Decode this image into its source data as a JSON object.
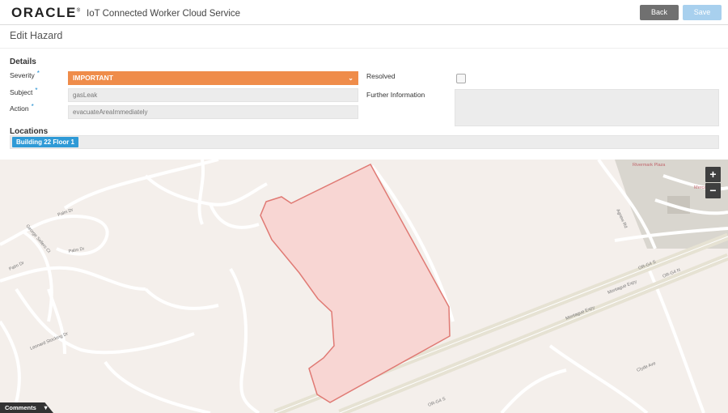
{
  "header": {
    "logo": "ORACLE",
    "logo_registered": "®",
    "app_title": "IoT Connected Worker Cloud Service",
    "back_label": "Back",
    "save_label": "Save"
  },
  "page": {
    "title": "Edit Hazard"
  },
  "details": {
    "section_title": "Details",
    "severity_label": "Severity",
    "severity_value": "IMPORTANT",
    "subject_label": "Subject",
    "subject_value": "gasLeak",
    "action_label": "Action",
    "action_value": "evacuateAreaImmediately",
    "resolved_label": "Resolved",
    "further_info_label": "Further Information",
    "further_info_value": "",
    "required_marker": "*"
  },
  "locations": {
    "section_title": "Locations",
    "chips": [
      "Building 22 Floor 1"
    ]
  },
  "map": {
    "zoom_in": "+",
    "zoom_out": "−",
    "street_labels": [
      "Palm Dr",
      "Palm Dr",
      "Palm Dr",
      "Leonard Stocking Dr",
      "George Sellers Ct",
      "Agnew Rd",
      "Montague Expy",
      "Montague Expy",
      "OR-G4 S",
      "OR-G4 N",
      "OR-G4 S",
      "Clyde Ave",
      "Rivermark Plaza",
      "Mercado"
    ],
    "hazard_fill": "#f8d6d3",
    "hazard_stroke": "#e07a74"
  },
  "footer": {
    "comments_label": "Comments",
    "comments_caret": "▼"
  },
  "colors": {
    "accent": "#1b8bd0",
    "severity": "#ef8c4a",
    "chip": "#2f9ad6"
  }
}
